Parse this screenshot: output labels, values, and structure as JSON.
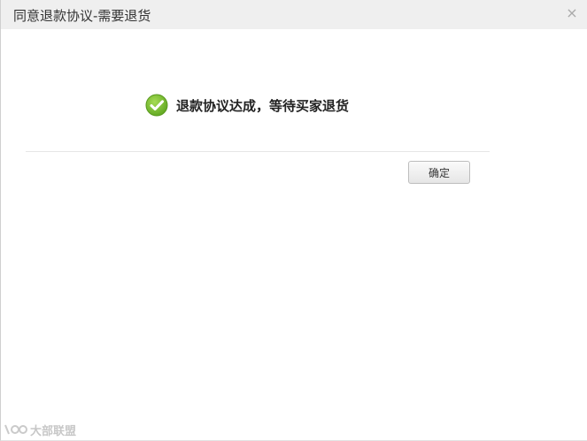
{
  "dialog": {
    "title": "同意退款协议-需要退货",
    "close_label": "×"
  },
  "message": {
    "icon": "check-circle-icon",
    "text": "退款协议达成，等待买家退货",
    "icon_color": "#6fb52c"
  },
  "actions": {
    "confirm_label": "确定"
  },
  "watermark": {
    "logo": "kaidi-logo",
    "text": "大部联盟"
  }
}
